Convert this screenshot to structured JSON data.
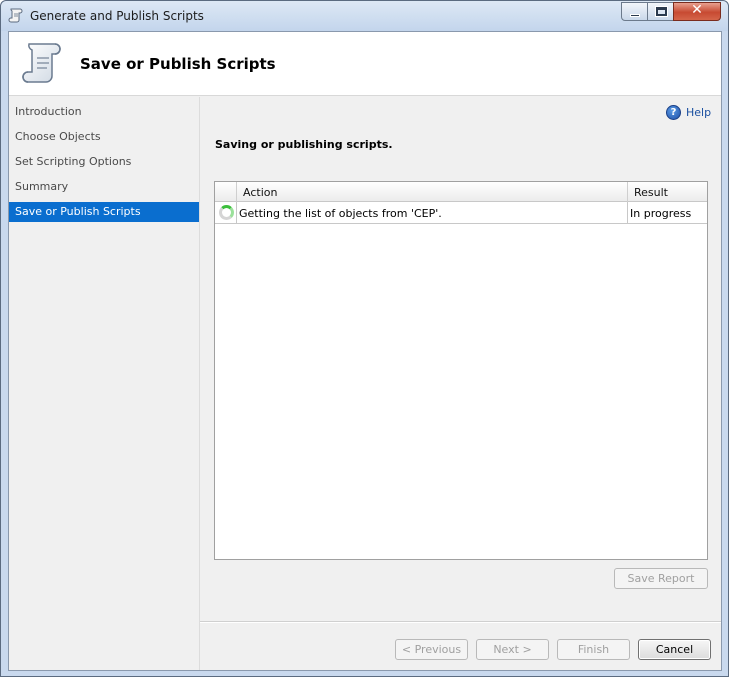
{
  "window": {
    "title": "Generate and Publish Scripts",
    "close_glyph": "✕"
  },
  "header": {
    "title": "Save or Publish Scripts"
  },
  "sidebar": {
    "items": [
      {
        "label": "Introduction"
      },
      {
        "label": "Choose Objects"
      },
      {
        "label": "Set Scripting Options"
      },
      {
        "label": "Summary"
      },
      {
        "label": "Save or Publish Scripts",
        "active": true
      }
    ]
  },
  "help": {
    "label": "Help",
    "glyph": "?"
  },
  "main": {
    "section_title": "Saving or publishing scripts."
  },
  "grid": {
    "columns": [
      "Action",
      "Result"
    ],
    "rows": [
      {
        "action": "Getting the list of objects from 'CEP'.",
        "result": "In progress",
        "status_icon": "spinner-icon"
      }
    ]
  },
  "buttons": {
    "save_report": "Save Report",
    "previous": "< Previous",
    "next": "Next >",
    "finish": "Finish",
    "cancel": "Cancel"
  },
  "colors": {
    "accent": "#0a6ecf",
    "progress": "#3cbf3c"
  }
}
